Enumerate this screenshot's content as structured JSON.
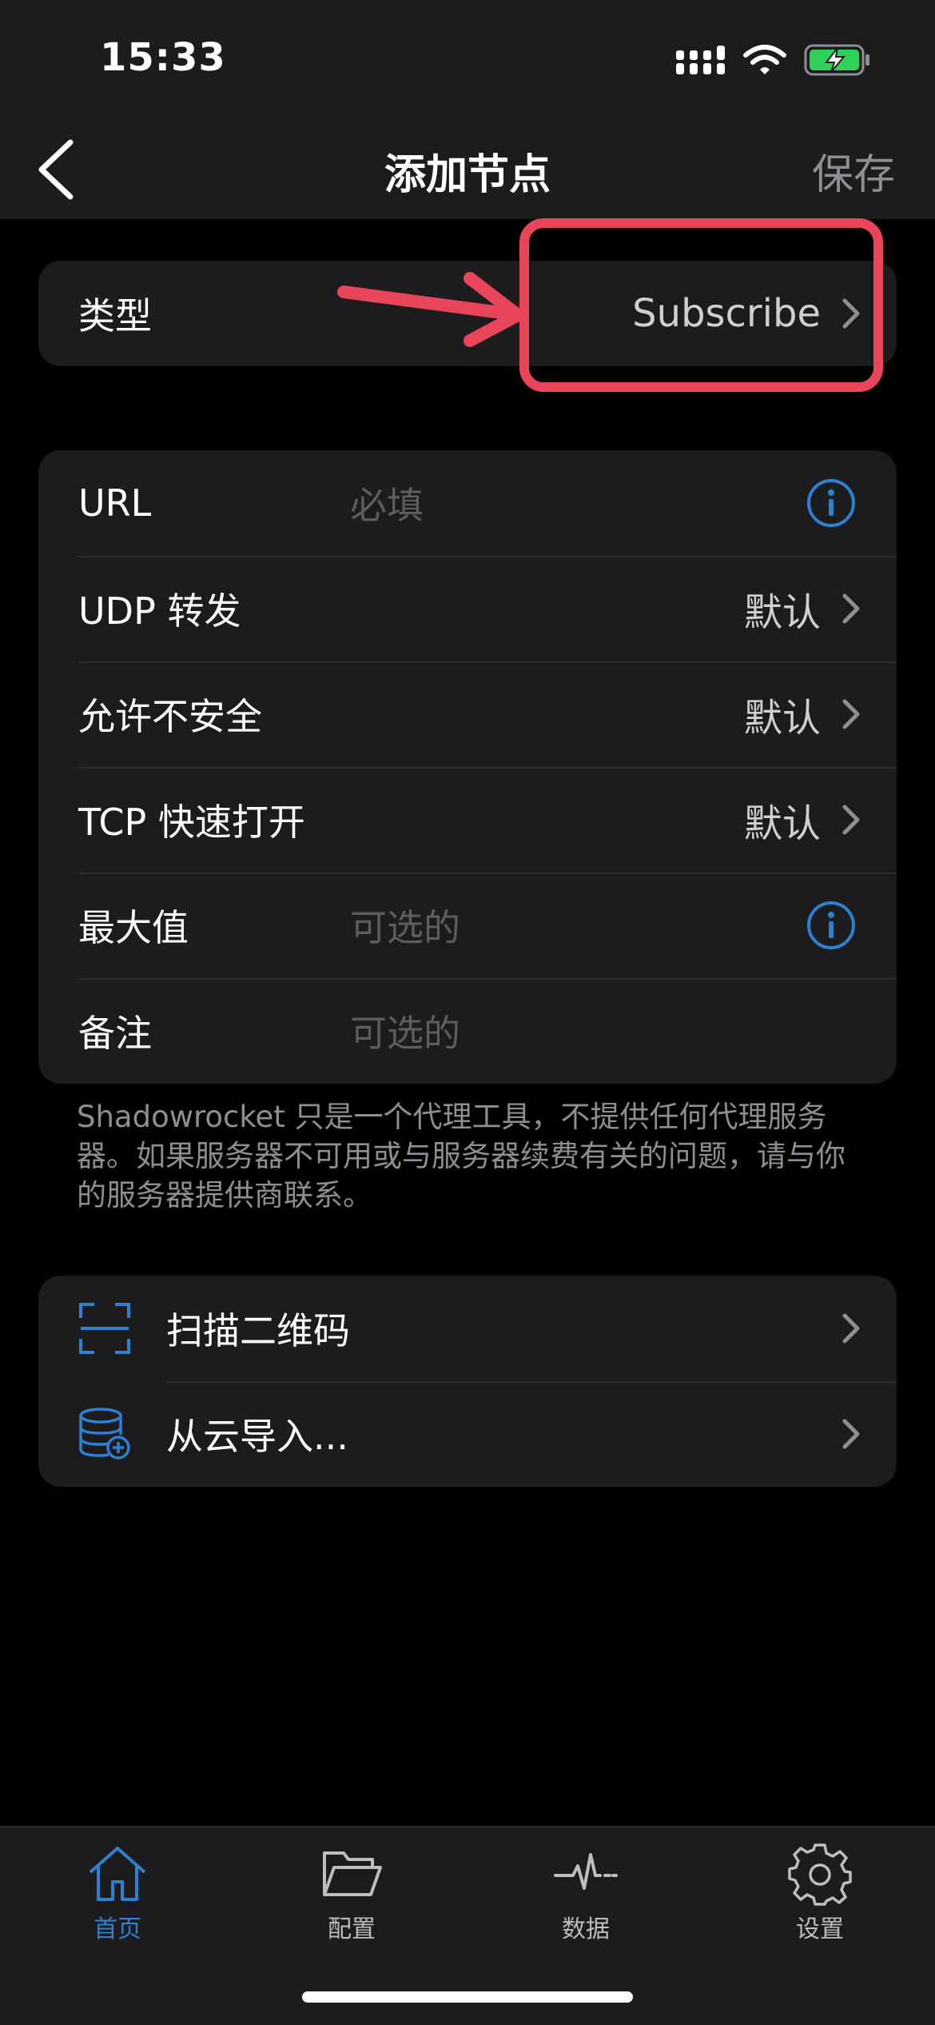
{
  "status_bar": {
    "time": "15:33"
  },
  "nav": {
    "title": "添加节点",
    "save_label": "保存"
  },
  "type_row": {
    "label": "类型",
    "value": "Subscribe"
  },
  "form_rows": [
    {
      "label": "URL",
      "placeholder": "必填",
      "accessory": "info"
    },
    {
      "label": "UDP 转发",
      "value": "默认",
      "accessory": "chevron"
    },
    {
      "label": "允许不安全",
      "value": "默认",
      "accessory": "chevron"
    },
    {
      "label": "TCP 快速打开",
      "value": "默认",
      "accessory": "chevron"
    },
    {
      "label": "最大值",
      "placeholder": "可选的",
      "accessory": "info"
    },
    {
      "label": "备注",
      "placeholder": "可选的"
    }
  ],
  "footnote": "Shadowrocket 只是一个代理工具，不提供任何代理服务器。如果服务器不可用或与服务器续费有关的问题，请与你的服务器提供商联系。",
  "actions": [
    {
      "label": "扫描二维码",
      "icon": "qr-scan-icon"
    },
    {
      "label": "从云导入...",
      "icon": "cloud-database-icon"
    }
  ],
  "tabs": [
    {
      "label": "首页",
      "icon": "home-icon",
      "active": true
    },
    {
      "label": "配置",
      "icon": "folder-icon",
      "active": false
    },
    {
      "label": "数据",
      "icon": "activity-icon",
      "active": false
    },
    {
      "label": "设置",
      "icon": "gear-icon",
      "active": false
    }
  ],
  "colors": {
    "accent": "#2f80d1",
    "highlight": "#e8455a",
    "battery": "#30d158"
  }
}
